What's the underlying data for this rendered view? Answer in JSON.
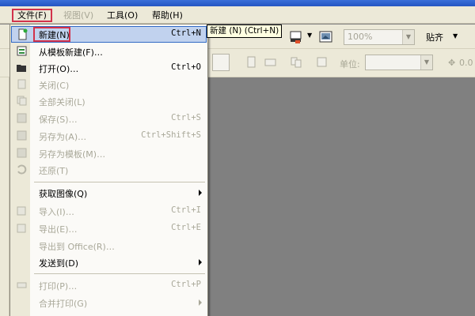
{
  "menubar": {
    "items": [
      {
        "label": "文件(F)",
        "state": "active"
      },
      {
        "label": "视图(V)",
        "state": "disabled"
      },
      {
        "label": "工具(O)",
        "state": "normal"
      },
      {
        "label": "帮助(H)",
        "state": "normal"
      }
    ]
  },
  "tooltip": {
    "text": "新建 (N) (Ctrl+N)"
  },
  "toolbar": {
    "zoom_value": "100%",
    "snap_label": "贴齐",
    "unit_label": "单位:",
    "partial_value": "0.0"
  },
  "file_menu": {
    "items": [
      {
        "label": "新建(N)",
        "shortcut": "Ctrl+N",
        "enabled": true,
        "highlighted": true,
        "icon": "new-doc-icon"
      },
      {
        "label": "从模板新建(F)…",
        "shortcut": "",
        "enabled": true,
        "icon": "template-icon"
      },
      {
        "label": "打开(O)…",
        "shortcut": "Ctrl+O",
        "enabled": true,
        "icon": "open-folder-icon"
      },
      {
        "label": "关闭(C)",
        "shortcut": "",
        "enabled": false,
        "icon": "close-doc-icon"
      },
      {
        "label": "全部关闭(L)",
        "shortcut": "",
        "enabled": false,
        "icon": "close-all-icon"
      },
      {
        "label": "保存(S)…",
        "shortcut": "Ctrl+S",
        "enabled": false,
        "icon": "save-icon"
      },
      {
        "label": "另存为(A)…",
        "shortcut": "Ctrl+Shift+S",
        "enabled": false,
        "icon": "save-as-icon"
      },
      {
        "label": "另存为模板(M)…",
        "shortcut": "",
        "enabled": false,
        "icon": "save-template-icon"
      },
      {
        "label": "还原(T)",
        "shortcut": "",
        "enabled": false,
        "icon": "revert-icon"
      },
      {
        "label": "获取图像(Q)",
        "shortcut": "",
        "enabled": true,
        "submenu": true
      },
      {
        "label": "导入(I)…",
        "shortcut": "Ctrl+I",
        "enabled": false,
        "icon": "import-icon"
      },
      {
        "label": "导出(E)…",
        "shortcut": "Ctrl+E",
        "enabled": false,
        "icon": "export-icon"
      },
      {
        "label": "导出到 Office(R)…",
        "shortcut": "",
        "enabled": false
      },
      {
        "label": "发送到(D)",
        "shortcut": "",
        "enabled": true,
        "submenu": true
      },
      {
        "label": "打印(P)…",
        "shortcut": "Ctrl+P",
        "enabled": false,
        "icon": "print-icon"
      },
      {
        "label": "合并打印(G)",
        "shortcut": "",
        "enabled": false,
        "submenu": true
      }
    ]
  },
  "colors": {
    "highlight_bg": "#c1d2ee",
    "highlight_border": "#316ac5",
    "annotation_red": "#d2324b",
    "canvas_grey": "#808080",
    "chrome": "#ece9d8"
  }
}
